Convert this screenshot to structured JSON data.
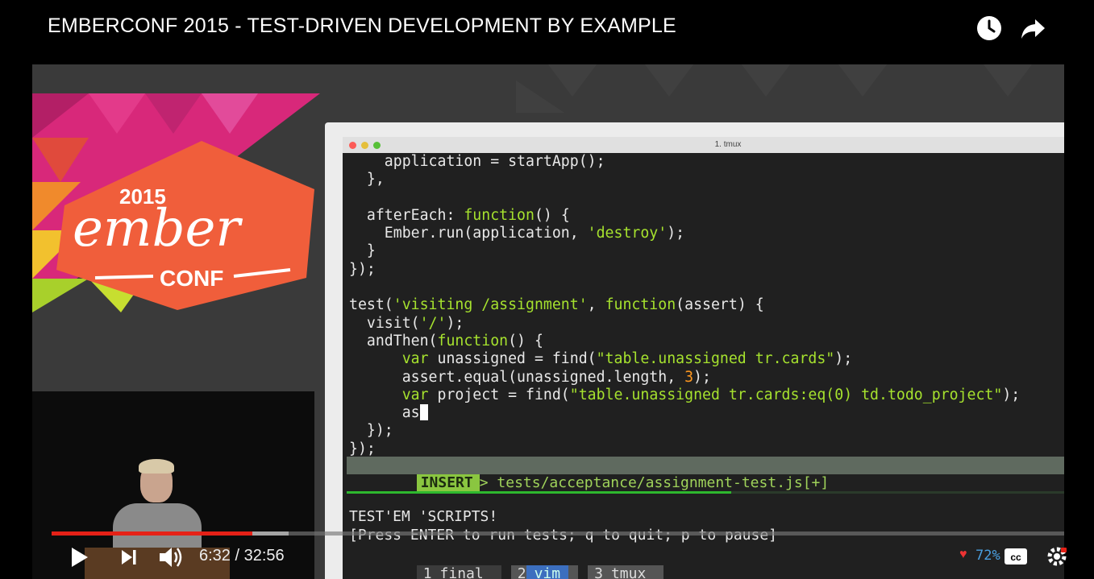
{
  "video": {
    "title": "EMBERCONF 2015 - TEST-DRIVEN DEVELOPMENT BY EXAMPLE",
    "icons": [
      "watch-later-icon",
      "share-icon"
    ]
  },
  "slide": {
    "logo_year": "2015",
    "logo_word": "ember",
    "logo_sub": "CONF",
    "logo_color": "#f05e3b"
  },
  "terminal": {
    "window_title": "1. tmux",
    "code_lines": [
      "    application = startApp();",
      "  },",
      "",
      "  afterEach: function() {",
      "    Ember.run(application, 'destroy');",
      "  }",
      "});",
      "",
      "test('visiting /assignment', function(assert) {",
      "  visit('/');",
      "  andThen(function() {",
      "      var unassigned = find(\"table.unassigned tr.cards\");",
      "      assert.equal(unassigned.length, 3);",
      "      var project = find(\"table.unassigned tr.cards:eq(0) td.todo_project\");",
      "      as",
      "  });",
      "});"
    ],
    "status_mode": "INSERT",
    "status_file": "> tests/acceptance/assignment-test.js[+]",
    "testem_title": "TEST'EM 'SCRIPTS!",
    "testem_hint": "[Press ENTER to run tests; q to quit; p to pause]",
    "tmux_tabs": [
      {
        "num": "1",
        "name": "final"
      },
      {
        "num": "2",
        "name": "vim"
      },
      {
        "num": "3",
        "name": "tmux"
      }
    ],
    "tmux_status_pct": "72%",
    "test_progress": 0.53
  },
  "player": {
    "current_time": "6:32",
    "separator": " / ",
    "duration": "32:56",
    "played_fraction": 0.198,
    "buffered_fraction": 0.234,
    "accent": "#e52117",
    "controls": [
      "play-icon",
      "next-icon",
      "volume-icon",
      "captions-icon",
      "settings-icon"
    ]
  }
}
